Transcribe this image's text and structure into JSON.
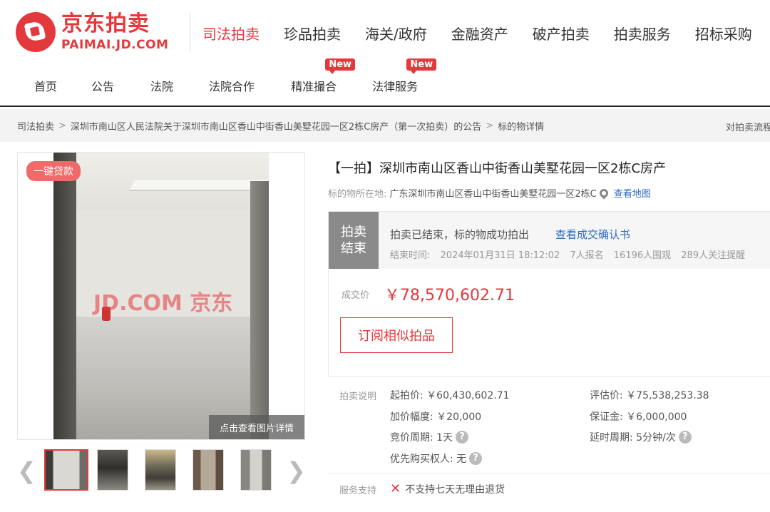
{
  "brand": {
    "cn": "京东拍卖",
    "en": "PAIMAI.JD.COM",
    "color": "#e4393c"
  },
  "main_nav": [
    "司法拍卖",
    "珍品拍卖",
    "海关/政府",
    "金融资产",
    "破产拍卖",
    "拍卖服务",
    "招标采购"
  ],
  "sub_nav": [
    {
      "label": "首页",
      "badge": ""
    },
    {
      "label": "公告",
      "badge": ""
    },
    {
      "label": "法院",
      "badge": ""
    },
    {
      "label": "法院合作",
      "badge": ""
    },
    {
      "label": "精准撮合",
      "badge": "New"
    },
    {
      "label": "法律服务",
      "badge": "New"
    }
  ],
  "breadcrumb": {
    "items": [
      "司法拍卖",
      "深圳市南山区人民法院关于深圳市南山区香山中街香山美墅花园一区2栋C房产（第一次拍卖）的公告",
      "标的物详情"
    ],
    "sep": ">",
    "right": "对拍卖流程"
  },
  "gallery": {
    "loan_badge": "一键贷款",
    "watermark": "JD.COM 京东",
    "detail_button": "点击查看图片详情",
    "prev": "❮",
    "next": "❯",
    "thumbnail_count": 5
  },
  "item": {
    "title": "【一拍】深圳市南山区香山中街香山美墅花园一区2栋C房产",
    "location_label": "标的物所在地:",
    "location_value": "广东深圳市南山区香山中街香山美墅花园一区2栋C",
    "map_link": "查看地图"
  },
  "status": {
    "tag_line1": "拍卖",
    "tag_line2": "结束",
    "message": "拍卖已结束，标的物成功拍出",
    "confirm_link": "查看成交确认书",
    "end_time_label": "结束时间:",
    "end_time": "2024年01月31日 18:12:02",
    "signups": "7人报名",
    "viewers": "16196人围观",
    "followers": "289人关注提醒",
    "price_label": "成交价",
    "price_value": "￥78,570,602.71",
    "subscribe_button": "订阅相似拍品"
  },
  "auction_info": {
    "section_label": "拍卖说明",
    "start_price": "起拍价: ￥60,430,602.71",
    "appraisal": "评估价: ￥75,538,253.38",
    "increment": "加价幅度: ￥20,000",
    "deposit": "保证金: ￥6,000,000",
    "bid_period": "竞价周期: 1天",
    "extension": "延时周期: 5分钟/次",
    "priority": "优先购买权人: 无",
    "help_icon": "?"
  },
  "service": {
    "label": "服务支持",
    "no_return": "不支持七天无理由退货",
    "icon": "✕"
  }
}
